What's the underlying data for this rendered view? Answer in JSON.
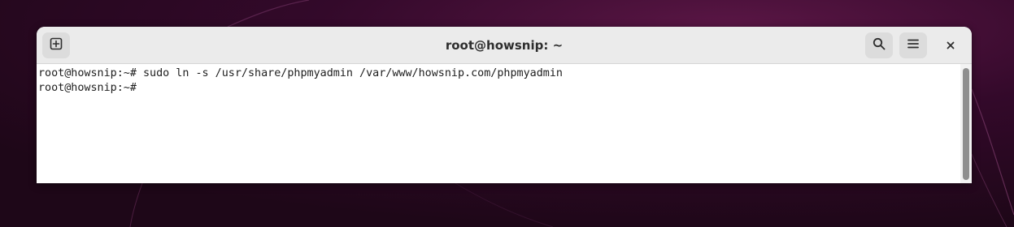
{
  "window": {
    "title": "root@howsnip: ~"
  },
  "header": {
    "new_tab_icon": "new-tab-icon",
    "search_icon": "search-icon",
    "menu_icon": "hamburger-menu-icon",
    "close_icon": "close-icon"
  },
  "terminal": {
    "lines": [
      "root@howsnip:~# sudo ln -s /usr/share/phpmyadmin /var/www/howsnip.com/phpmyadmin",
      "root@howsnip:~#"
    ]
  },
  "colors": {
    "desktop_background": "#2b0a22",
    "headerbar": "#ebebeb",
    "terminal_background": "#ffffff",
    "terminal_text": "#1e1e1e"
  }
}
